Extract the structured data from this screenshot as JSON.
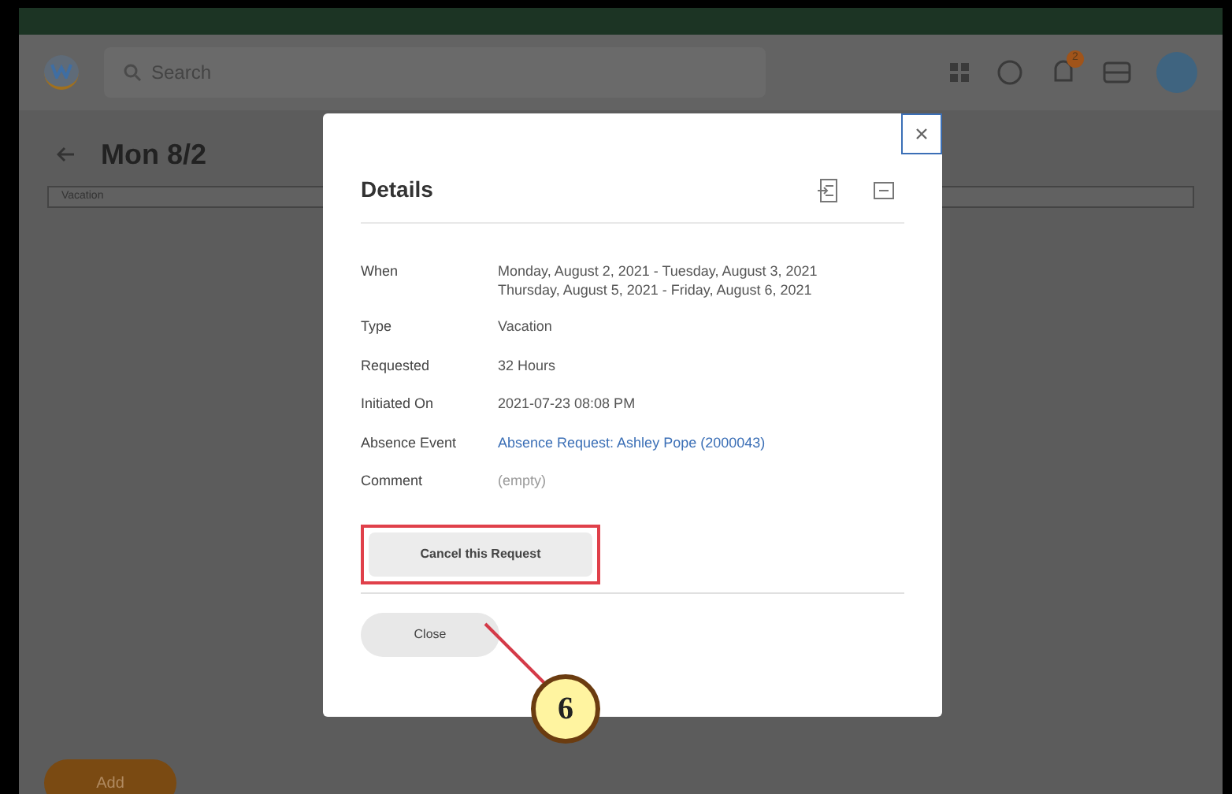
{
  "header": {
    "search": {
      "placeholder": "Search"
    },
    "notification_count": "2"
  },
  "page": {
    "title": "Mon 8/2",
    "entry": "Vacation",
    "add_button": "Add"
  },
  "dialog": {
    "title": "Details",
    "fields": [
      {
        "label": "When",
        "lines": [
          "Monday, August 2, 2021 - Tuesday, August 3, 2021",
          "Thursday, August 5, 2021 - Friday, August 6, 2021"
        ],
        "kind": "text"
      },
      {
        "label": "Type",
        "lines": [
          "Vacation"
        ],
        "kind": "text"
      },
      {
        "label": "Requested",
        "lines": [
          "32 Hours"
        ],
        "kind": "text"
      },
      {
        "label": "Initiated On",
        "lines": [
          "2021-07-23 08:08 PM"
        ],
        "kind": "text"
      },
      {
        "label": "Absence Event",
        "lines": [
          "Absence Request: Ashley Pope (2000043)"
        ],
        "kind": "link"
      },
      {
        "label": "Comment",
        "lines": [
          "(empty)"
        ],
        "kind": "muted"
      }
    ],
    "action_button": "Cancel this Request",
    "close_button": "Close"
  },
  "callout": {
    "number": "6"
  }
}
